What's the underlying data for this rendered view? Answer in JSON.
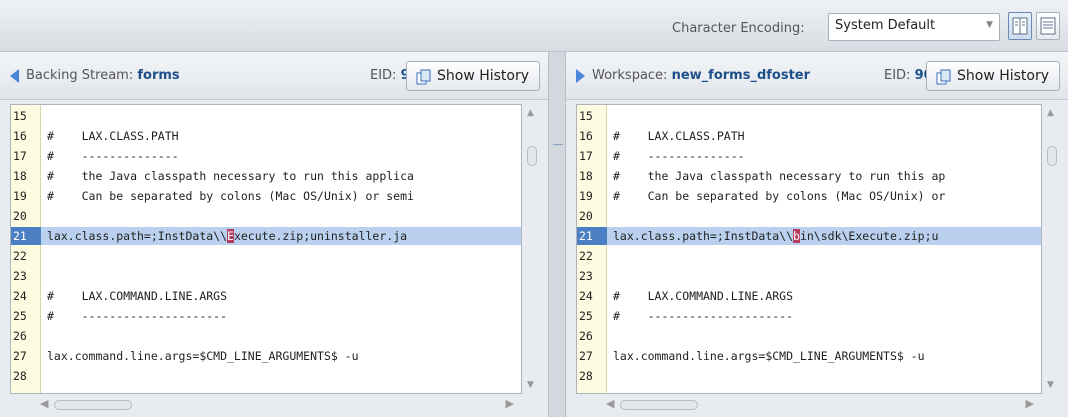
{
  "toolbar": {
    "encoding_label": "Character Encoding:",
    "encoding_value": "System Default"
  },
  "left_panel": {
    "title_prefix": "Backing Stream:",
    "title_name": "forms",
    "eid_label": "EID:",
    "eid_value": "91",
    "history_label": "Show History"
  },
  "right_panel": {
    "title_prefix": "Workspace:",
    "title_name": "new_forms_dfoster",
    "eid_label": "EID:",
    "eid_value": "90",
    "history_label": "Show History"
  },
  "left_lines": [
    {
      "n": "15",
      "t": ""
    },
    {
      "n": "16",
      "t": "#    LAX.CLASS.PATH"
    },
    {
      "n": "17",
      "t": "#    --------------"
    },
    {
      "n": "18",
      "t": "#    the Java classpath necessary to run this applica"
    },
    {
      "n": "19",
      "t": "#    Can be separated by colons (Mac OS/Unix) or semi"
    },
    {
      "n": "20",
      "t": ""
    },
    {
      "n": "21",
      "t": "lax.class.path=;InstData\\\\",
      "m": "E",
      "t2": "xecute.zip;uninstaller.ja"
    },
    {
      "n": "22",
      "t": ""
    },
    {
      "n": "23",
      "t": ""
    },
    {
      "n": "24",
      "t": "#    LAX.COMMAND.LINE.ARGS"
    },
    {
      "n": "25",
      "t": "#    ---------------------"
    },
    {
      "n": "26",
      "t": ""
    },
    {
      "n": "27",
      "t": "lax.command.line.args=$CMD_LINE_ARGUMENTS$ -u"
    },
    {
      "n": "28",
      "t": ""
    }
  ],
  "right_lines": [
    {
      "n": "15",
      "t": ""
    },
    {
      "n": "16",
      "t": "#    LAX.CLASS.PATH"
    },
    {
      "n": "17",
      "t": "#    --------------"
    },
    {
      "n": "18",
      "t": "#    the Java classpath necessary to run this ap"
    },
    {
      "n": "19",
      "t": "#    Can be separated by colons (Mac OS/Unix) or"
    },
    {
      "n": "20",
      "t": ""
    },
    {
      "n": "21",
      "t": "lax.class.path=;InstData\\\\",
      "m": "b",
      "t2": "in\\sdk\\Execute.zip;u"
    },
    {
      "n": "22",
      "t": ""
    },
    {
      "n": "23",
      "t": ""
    },
    {
      "n": "24",
      "t": "#    LAX.COMMAND.LINE.ARGS"
    },
    {
      "n": "25",
      "t": "#    ---------------------"
    },
    {
      "n": "26",
      "t": ""
    },
    {
      "n": "27",
      "t": "lax.command.line.args=$CMD_LINE_ARGUMENTS$ -u"
    },
    {
      "n": "28",
      "t": ""
    }
  ],
  "highlighted_line": "21",
  "colors": {
    "accent": "#4a86d8",
    "diff_mark": "#b43c5e",
    "highlight": "#b9d1ee"
  }
}
